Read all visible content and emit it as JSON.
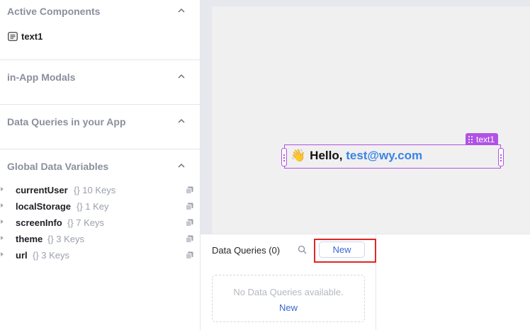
{
  "sidebar": {
    "active_components": {
      "title": "Active Components",
      "items": [
        {
          "label": "text1",
          "icon": "text-widget-icon"
        }
      ]
    },
    "modals": {
      "title": "in-App Modals"
    },
    "data_queries": {
      "title": "Data Queries in your App"
    },
    "global_variables": {
      "title": "Global Data Variables",
      "items": [
        {
          "name": "currentUser",
          "meta": "{} 10 Keys"
        },
        {
          "name": "localStorage",
          "meta": "{} 1 Key"
        },
        {
          "name": "screenInfo",
          "meta": "{} 7 Keys"
        },
        {
          "name": "theme",
          "meta": "{} 3 Keys"
        },
        {
          "name": "url",
          "meta": "{} 3 Keys"
        }
      ]
    }
  },
  "canvas": {
    "widget_tag": "text1",
    "text": {
      "emoji": "👋",
      "greeting": "Hello,",
      "email": "test@wy.com"
    }
  },
  "query_panel": {
    "title": "Data Queries (0)",
    "new_button": "New",
    "empty_text": "No Data Queries available.",
    "empty_new_link": "New"
  },
  "colors": {
    "selection": "#b052e6",
    "link": "#3867d6",
    "highlight": "#e12626"
  }
}
